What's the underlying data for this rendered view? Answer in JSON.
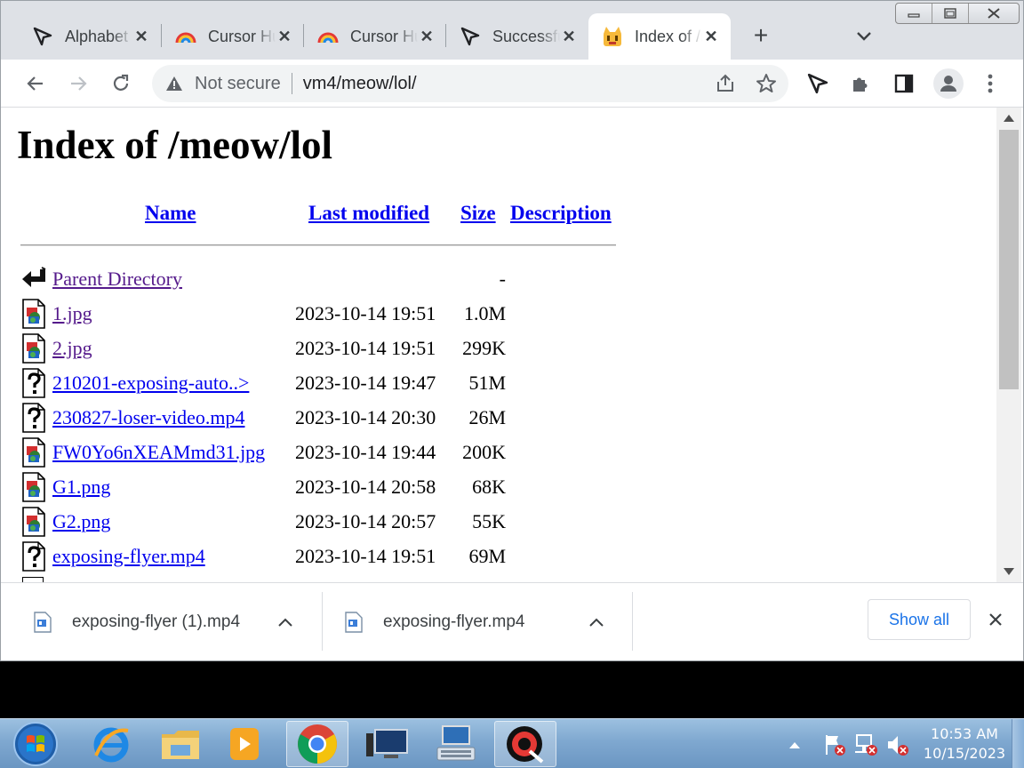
{
  "browser": {
    "tabs": [
      {
        "title": "Alphabet",
        "favicon": "cursor-arrow-icon",
        "active": false
      },
      {
        "title": "Cursor Hunt",
        "favicon": "rainbow-icon",
        "active": false
      },
      {
        "title": "Cursor Hunt",
        "favicon": "rainbow-icon",
        "active": false
      },
      {
        "title": "Successful",
        "favicon": "cursor-arrow-icon",
        "active": false
      },
      {
        "title": "Index of /meow/lol",
        "favicon": "cat-icon",
        "active": true
      }
    ],
    "new_tab_label": "+",
    "toolbar": {
      "security_label": "Not secure",
      "url": "vm4/meow/lol/"
    }
  },
  "page": {
    "heading": "Index of /meow/lol",
    "columns": {
      "name": "Name",
      "last_modified": "Last modified",
      "size": "Size",
      "description": "Description"
    },
    "rows": [
      {
        "icon": "back-arrow-icon",
        "name": "Parent Directory",
        "date": "",
        "size": "-",
        "visited": true
      },
      {
        "icon": "image-file-icon",
        "name": "1.jpg",
        "date": "2023-10-14 19:51",
        "size": "1.0M",
        "visited": true
      },
      {
        "icon": "image-file-icon",
        "name": "2.jpg",
        "date": "2023-10-14 19:51",
        "size": "299K",
        "visited": true
      },
      {
        "icon": "unknown-file-icon",
        "name": "210201-exposing-auto..>",
        "date": "2023-10-14 19:47",
        "size": "51M",
        "visited": false
      },
      {
        "icon": "unknown-file-icon",
        "name": "230827-loser-video.mp4",
        "date": "2023-10-14 20:30",
        "size": "26M",
        "visited": false
      },
      {
        "icon": "image-file-icon",
        "name": "FW0Yo6nXEAMmd31.jpg",
        "date": "2023-10-14 19:44",
        "size": "200K",
        "visited": false
      },
      {
        "icon": "image-file-icon",
        "name": "G1.png",
        "date": "2023-10-14 20:58",
        "size": "68K",
        "visited": false
      },
      {
        "icon": "image-file-icon",
        "name": "G2.png",
        "date": "2023-10-14 20:57",
        "size": "55K",
        "visited": false
      },
      {
        "icon": "unknown-file-icon",
        "name": "exposing-flyer.mp4",
        "date": "2023-10-14 19:51",
        "size": "69M",
        "visited": false
      }
    ]
  },
  "downloads": {
    "items": [
      {
        "name": "exposing-flyer (1).mp4"
      },
      {
        "name": "exposing-flyer.mp4"
      }
    ],
    "show_all_label": "Show all"
  },
  "taskbar": {
    "time": "10:53 AM",
    "date": "10/15/2023"
  },
  "colors": {
    "link": "#0000ee",
    "visited_link": "#551a8b",
    "accent": "#1a73e8"
  }
}
